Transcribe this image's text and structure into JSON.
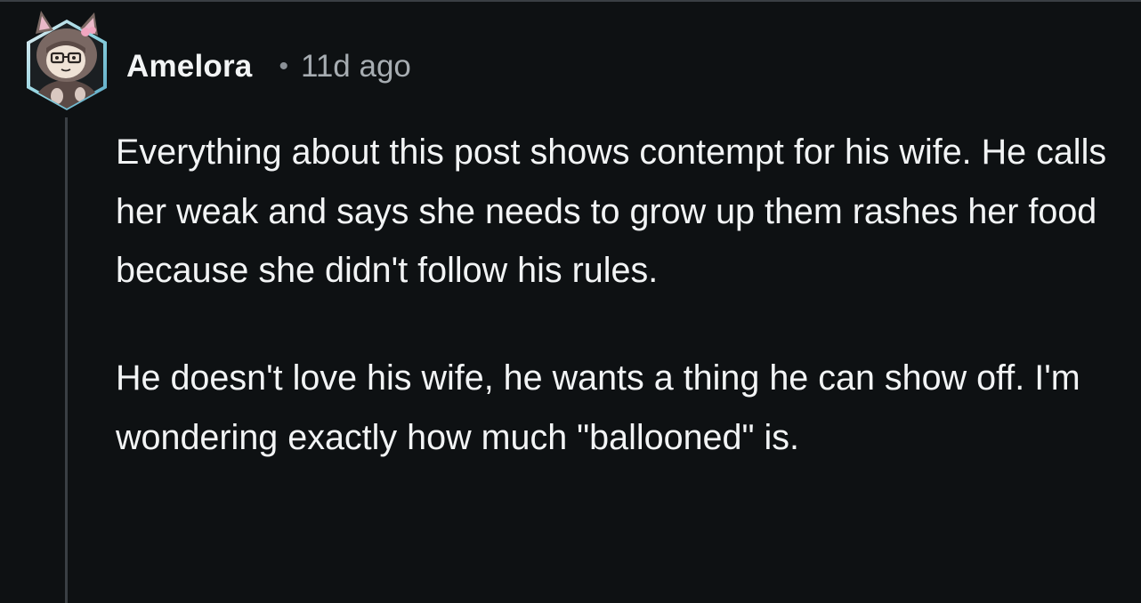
{
  "comment": {
    "author": "Amelora",
    "separator": "•",
    "time_ago": "11d ago",
    "avatar_icon": "snoo-avatar-hooded-glasses",
    "paragraphs": [
      "Everything about this post shows contempt for his wife. He calls her weak and says she needs to grow up them rashes her food because she didn't follow his rules.",
      "He doesn't love his wife, he wants a thing he can show off. I'm wondering exactly how much \"ballooned\" is."
    ]
  },
  "colors": {
    "background": "#0e1113",
    "text_primary": "#f2f4f5",
    "text_secondary": "#a7adb2",
    "thread_line": "#3a3f44",
    "avatar_frame": "#7ec8d8"
  }
}
